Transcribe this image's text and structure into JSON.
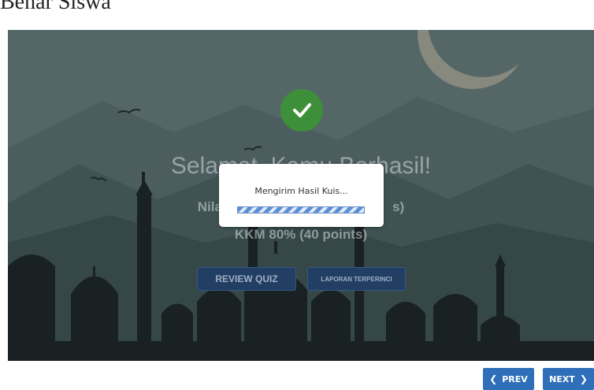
{
  "document": {
    "title": "Benar Siswa"
  },
  "quiz": {
    "headline": "Selamat, Kamu Berhasil!",
    "score_line": "Nilai Kamu",
    "score_line_suffix": "s)",
    "kkm_line": "KKM  80% (40 points)",
    "review_label": "REVIEW QUIZ",
    "report_label": "LAPORAN TERPERINCI"
  },
  "modal": {
    "message": "Mengirim Hasil Kuis...",
    "progress": 1.0
  },
  "nav": {
    "prev_label": "PREV",
    "next_label": "NEXT"
  },
  "colors": {
    "accent": "#2f6fb9",
    "success": "#3e8f3a",
    "sky": "#889ea0",
    "silhouette": "#1e2627"
  }
}
